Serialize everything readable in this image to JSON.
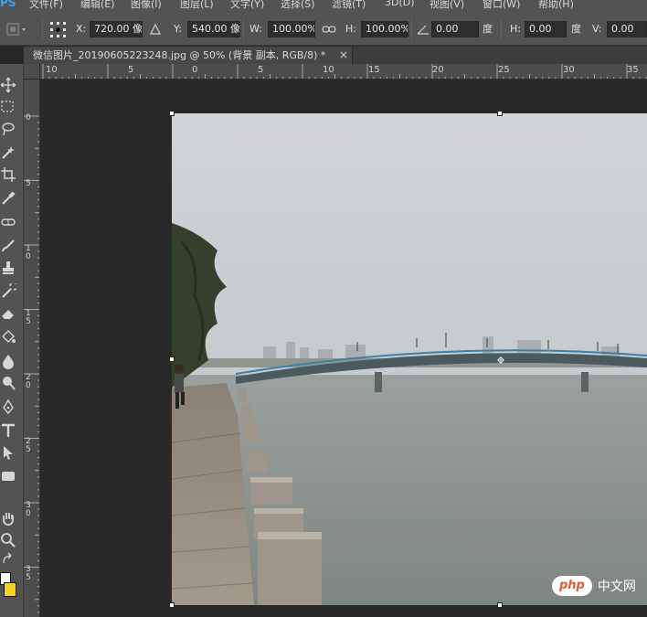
{
  "menu": {
    "app_logo": "PS",
    "items": [
      "文件(F)",
      "编辑(E)",
      "图像(I)",
      "图层(L)",
      "文字(Y)",
      "选择(S)",
      "滤镜(T)",
      "3D(D)",
      "视图(V)",
      "窗口(W)",
      "帮助(H)"
    ]
  },
  "options": {
    "x_label": "X:",
    "x_value": "720.00 像",
    "y_label": "Y:",
    "y_value": "540.00 像",
    "w_label": "W:",
    "w_value": "100.00%",
    "h_label": "H:",
    "h_value": "100.00%",
    "angle_value": "0.00",
    "angle_unit": "度",
    "hskew_label": "H:",
    "hskew_value": "0.00",
    "hskew_unit": "度",
    "vskew_label": "V:",
    "vskew_value": "0.00"
  },
  "document": {
    "tab_title": "微信图片_20190605223248.jpg @ 50% (背景 副本, RGB/8) *",
    "close_glyph": "×"
  },
  "ruler": {
    "horizontal": [
      "10",
      "5",
      "0",
      "5",
      "10",
      "15",
      "20",
      "25",
      "30",
      "35"
    ],
    "vertical": [
      "0",
      "5",
      "10",
      "15",
      "20",
      "25",
      "30",
      "35"
    ]
  },
  "tools": [
    "move-icon",
    "marquee-icon",
    "lasso-icon",
    "quick-select-icon",
    "crop-icon",
    "eyedropper-icon",
    "healing-brush-icon",
    "brush-icon",
    "clone-stamp-icon",
    "history-brush-icon",
    "eraser-icon",
    "paint-bucket-icon",
    "blur-icon",
    "dodge-icon",
    "pen-icon",
    "type-icon",
    "path-select-icon",
    "rectangle-icon",
    "hand-icon",
    "zoom-icon"
  ],
  "colors": {
    "foreground": "#ffffff",
    "background": "#f5d21b",
    "ps_blue": "#31a8ff",
    "panel": "#535353"
  },
  "watermark": {
    "logo": "php",
    "text": "中文网"
  }
}
